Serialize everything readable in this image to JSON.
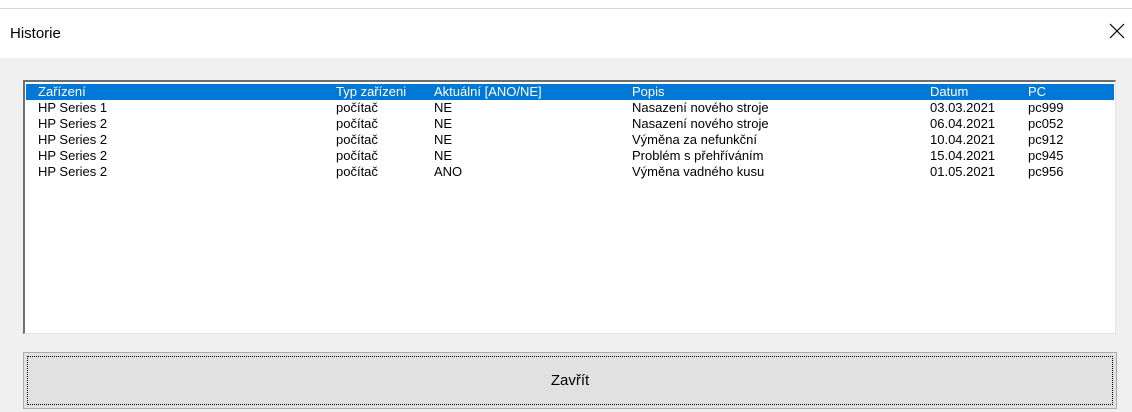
{
  "window": {
    "title": "Historie"
  },
  "list": {
    "columns": [
      "Zařízení",
      "Typ zařízeni",
      "Aktuální [ANO/NE]",
      "Popis",
      "Datum",
      "PC"
    ],
    "rows": [
      [
        "HP Series 1",
        "počítač",
        "NE",
        "Nasazení nového stroje",
        "03.03.2021",
        "pc999"
      ],
      [
        "HP Series 2",
        "počítač",
        "NE",
        "Nasazení nového stroje",
        "06.04.2021",
        "pc052"
      ],
      [
        "HP Series 2",
        "počítač",
        "NE",
        "Výměna za nefunkční",
        "10.04.2021",
        "pc912"
      ],
      [
        "HP Series 2",
        "počítač",
        "NE",
        "Problém s přehříváním",
        "15.04.2021",
        "pc945"
      ],
      [
        "HP Series 2",
        "počítač",
        "ANO",
        "Výměna vadného kusu",
        "01.05.2021",
        "pc956"
      ]
    ],
    "selected_row_color": "#0078d7"
  },
  "footer": {
    "close_label": "Zavřít"
  },
  "icons": {
    "close": "close-icon"
  }
}
